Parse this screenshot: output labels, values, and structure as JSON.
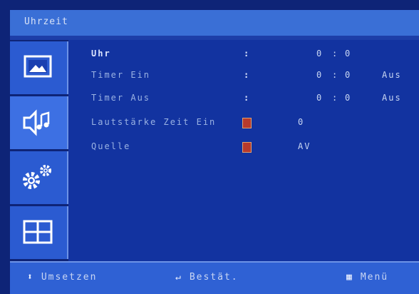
{
  "header": {
    "title": "Uhrzeit"
  },
  "sidebar": {
    "items": [
      {
        "icon": "picture-icon"
      },
      {
        "icon": "sound-icon"
      },
      {
        "icon": "settings-gears-icon"
      },
      {
        "icon": "grid-icon"
      }
    ]
  },
  "menu": {
    "rows": [
      {
        "label": "Uhr",
        "separator": ":",
        "hours": "0",
        "time_sep": ":",
        "minutes": "0"
      },
      {
        "label": "Timer Ein",
        "separator": ":",
        "hours": "0",
        "time_sep": ":",
        "minutes": "0",
        "state": "Aus"
      },
      {
        "label": "Timer Aus",
        "separator": ":",
        "hours": "0",
        "time_sep": ":",
        "minutes": "0",
        "state": "Aus"
      },
      {
        "label": "Lautstärke Zeit Ein",
        "value": "0"
      },
      {
        "label": "Quelle",
        "value": "AV"
      }
    ]
  },
  "footer": {
    "move": {
      "glyph": "⬍",
      "label": "Umsetzen"
    },
    "confirm": {
      "glyph": "↵",
      "label": "Bestät."
    },
    "menu": {
      "glyph": "▦",
      "label": "Menü"
    }
  },
  "colors": {
    "background": "#0e2477",
    "panel": "#1233a0",
    "accent": "#3a6fd6",
    "marker": "#b83a2c"
  }
}
